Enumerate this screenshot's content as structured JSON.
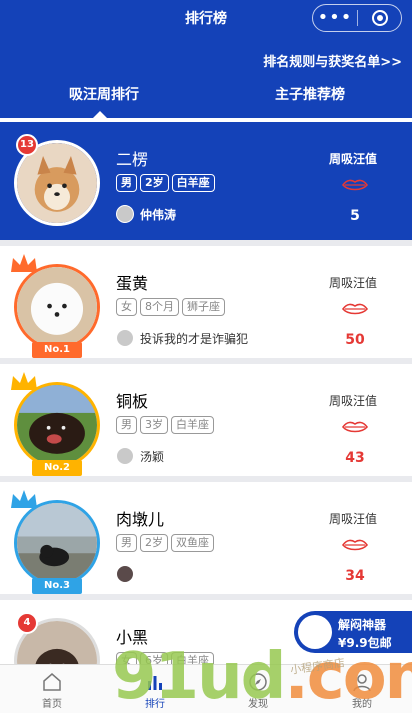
{
  "header": {
    "title": "排行榜",
    "capsule_dots": "•••",
    "rules_link": "排名规则与获奖名单>>",
    "tabs": [
      {
        "label": "吸汪周排行",
        "active": true
      },
      {
        "label": "主子推荐榜",
        "active": false
      }
    ]
  },
  "colors": {
    "primary": "#1442b8",
    "accent_red": "#e53935",
    "rank1": "#ff6a2c",
    "rank2": "#ffb300",
    "rank3": "#2fa3e6"
  },
  "score_label": "周吸汪值",
  "items": [
    {
      "rank_badge": "13",
      "name": "二楞",
      "tags": [
        "男",
        "2岁",
        "白羊座"
      ],
      "owner": "仲伟涛",
      "score": "5"
    },
    {
      "rank_badge": "No.1",
      "name": "蛋黄",
      "tags": [
        "女",
        "8个月",
        "狮子座"
      ],
      "owner": "投诉我的才是诈骗犯",
      "score": "50"
    },
    {
      "rank_badge": "No.2",
      "name": "铜板",
      "tags": [
        "男",
        "3岁",
        "白羊座"
      ],
      "owner": "汤颖",
      "score": "43"
    },
    {
      "rank_badge": "No.3",
      "name": "肉墩儿",
      "tags": [
        "男",
        "2岁",
        "双鱼座"
      ],
      "owner": "",
      "score": "34"
    },
    {
      "rank_badge": "4",
      "name": "小黑",
      "tags": [
        "女",
        "6岁",
        "白羊座"
      ],
      "owner": "",
      "score": ""
    }
  ],
  "promo": {
    "line1": "解闷神器",
    "line2": "¥9.9包邮"
  },
  "bottom_nav": [
    {
      "label": "首页",
      "icon": "home-icon"
    },
    {
      "label": "排行",
      "icon": "chart-icon"
    },
    {
      "label": "发现",
      "icon": "compass-icon"
    },
    {
      "label": "我的",
      "icon": "user-icon"
    }
  ],
  "watermark": {
    "main": "91ud",
    "suffix": ".com",
    "sub": "小程序商店"
  }
}
